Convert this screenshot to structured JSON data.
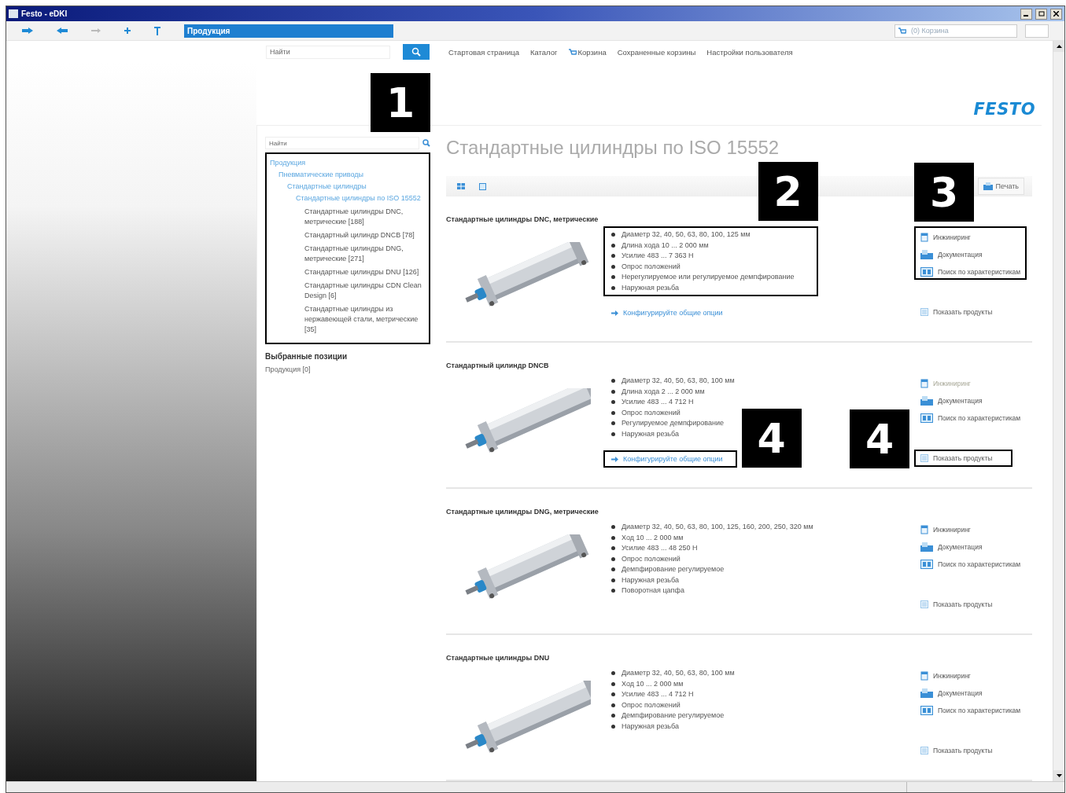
{
  "window": {
    "title": "Festo - eDKI"
  },
  "toolbar": {
    "address": "Продукция",
    "cart_field": "(0) Корзина"
  },
  "top_nav": {
    "search": {
      "placeholder": "Найти"
    },
    "links": [
      {
        "label": "Стартовая страница",
        "kind": "text"
      },
      {
        "label": "Каталог",
        "kind": "text"
      },
      {
        "label": "Корзина",
        "kind": "cart"
      },
      {
        "label": "Сохраненные корзины",
        "kind": "text"
      },
      {
        "label": "Настройки пользователя",
        "kind": "text"
      }
    ]
  },
  "logo": "FESTO",
  "sidebar": {
    "search": {
      "placeholder": "Найти"
    },
    "tree": {
      "marked": true,
      "callout": "1",
      "items": [
        {
          "label": "Продукция",
          "children": [
            {
              "label": "Пневматические приводы",
              "children": [
                {
                  "label": "Стандартные цилиндры",
                  "children": [
                    {
                      "label": "Стандартные цилиндры по ISO 15552",
                      "children": [
                        {
                          "label": "Стандартные цилиндры DNC, метрические [188]"
                        },
                        {
                          "label": "Стандартный цилиндр DNCB [78]"
                        },
                        {
                          "label": "Стандартные цилиндры DNG, метрические [271]"
                        },
                        {
                          "label": "Стандартные цилиндры DNU [126]"
                        },
                        {
                          "label": "Стандартные цилиндры CDN Clean Design [6]"
                        },
                        {
                          "label": "Стандартные цилиндры из нержавеющей стали, метрические [35]"
                        }
                      ]
                    }
                  ]
                }
              ]
            }
          ]
        }
      ]
    },
    "selected_heading": "Выбранные позиции",
    "selected_items": [
      "Продукция [0]"
    ]
  },
  "page": {
    "title": "Стандартные цилиндры по ISO 15552",
    "print_button": "Печать"
  },
  "products": [
    {
      "title": "Стандартные цилиндры DNC, метрические",
      "features_marked": true,
      "features_callout": "2",
      "features": [
        "Диаметр 32, 40, 50, 63, 80, 100, 125 мм",
        "Длина хода 10 ... 2 000 мм",
        "Усилие 483 ... 7 363 Н",
        "Опрос положений",
        "Нерегулируемое или регулируемое демпфирование",
        "Наружная резьба"
      ],
      "configure": {
        "label": "Конфигурируйте общие опции",
        "marked": false
      },
      "actions_marked": true,
      "actions_callout": "3",
      "actions": [
        {
          "kind": "engineering",
          "label": "Инжиниринг",
          "disabled": false
        },
        {
          "kind": "docs",
          "label": "Документация",
          "disabled": false
        },
        {
          "kind": "search",
          "label": "Поиск по характеристикам",
          "disabled": false
        }
      ],
      "show_products": {
        "label": "Показать продукты",
        "marked": false
      }
    },
    {
      "title": "Стандартный цилиндр DNCB",
      "features_marked": false,
      "features": [
        "Диаметр 32, 40, 50, 63, 80, 100 мм",
        "Длина хода 2 ... 2 000 мм",
        "Усилие 483 ... 4 712 Н",
        "Опрос положений",
        "Регулируемое демпфирование",
        "Наружная резьба"
      ],
      "configure": {
        "label": "Конфигурируйте общие опции",
        "marked": true,
        "callout": "4"
      },
      "actions_marked": false,
      "actions": [
        {
          "kind": "engineering",
          "label": "Инжиниринг",
          "disabled": true
        },
        {
          "kind": "docs",
          "label": "Документация",
          "disabled": false
        },
        {
          "kind": "search",
          "label": "Поиск по характеристикам",
          "disabled": false
        }
      ],
      "show_products": {
        "label": "Показать продукты",
        "marked": true,
        "callout": "4"
      }
    },
    {
      "title": "Стандартные цилиндры DNG, метрические",
      "features_marked": false,
      "features": [
        "Диаметр 32, 40, 50, 63, 80, 100, 125, 160, 200, 250, 320 мм",
        "Ход 10 ... 2 000 мм",
        "Усилие 483 ... 48 250 Н",
        "Опрос положений",
        "Демпфирование регулируемое",
        "Наружная резьба",
        "Поворотная цапфа"
      ],
      "actions_marked": false,
      "actions": [
        {
          "kind": "engineering",
          "label": "Инжиниринг",
          "disabled": false
        },
        {
          "kind": "docs",
          "label": "Документация",
          "disabled": false
        },
        {
          "kind": "search",
          "label": "Поиск по характеристикам",
          "disabled": false
        }
      ],
      "show_products": {
        "label": "Показать продукты",
        "marked": false
      }
    },
    {
      "title": "Стандартные цилиндры DNU",
      "features_marked": false,
      "features": [
        "Диаметр 32, 40, 50, 63, 80, 100 мм",
        "Ход 10 ... 2 000 мм",
        "Усилие 483 ... 4 712 Н",
        "Опрос положений",
        "Демпфирование регулируемое",
        "Наружная резьба"
      ],
      "actions_marked": false,
      "actions": [
        {
          "kind": "engineering",
          "label": "Инжиниринг",
          "disabled": false
        },
        {
          "kind": "docs",
          "label": "Документация",
          "disabled": false
        },
        {
          "kind": "search",
          "label": "Поиск по характеристикам",
          "disabled": false
        }
      ],
      "show_products": {
        "label": "Показать продукты",
        "marked": false
      }
    }
  ]
}
